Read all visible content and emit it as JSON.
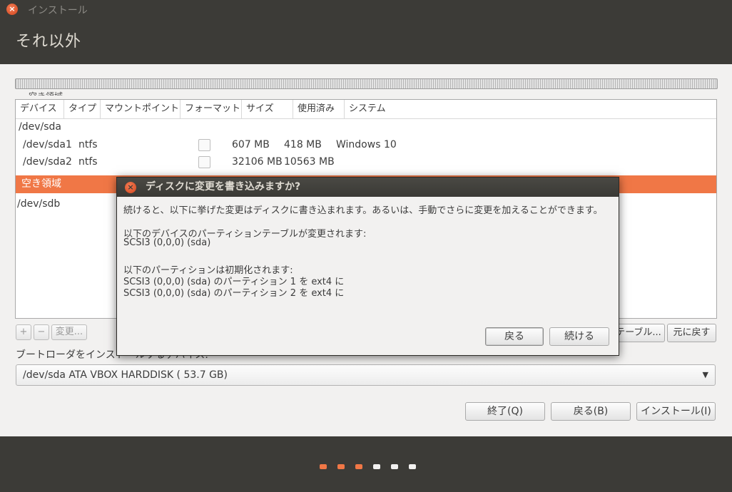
{
  "window": {
    "title": "インストール",
    "close_icon": "close-icon"
  },
  "page_title": "それ以外",
  "partition_legend_partial": "空き領域",
  "table": {
    "headers": [
      "デバイス",
      "タイプ",
      "マウントポイント",
      "フォーマット",
      "サイズ",
      "使用済み",
      "システム"
    ],
    "rows": [
      {
        "device": "/dev/sda",
        "type": "",
        "mount": "",
        "size": "",
        "used": "",
        "system": "",
        "selected": false
      },
      {
        "device": "/dev/sda1",
        "type": "ntfs",
        "mount": "",
        "size": "607 MB",
        "used": "418 MB",
        "system": "Windows 10",
        "selected": false
      },
      {
        "device": "/dev/sda2",
        "type": "ntfs",
        "mount": "",
        "size": "32106 MB",
        "used": "10563 MB",
        "system": "",
        "selected": false
      },
      {
        "device": "空き領域",
        "type": "",
        "mount": "",
        "size": "",
        "used": "",
        "system": "",
        "selected": true
      },
      {
        "device": "/dev/sdb",
        "type": "",
        "mount": "",
        "size": "",
        "used": "",
        "system": "",
        "selected": false
      }
    ]
  },
  "toolbar": {
    "add": "+",
    "remove": "−",
    "change": "変更...",
    "new_table": "テーブル...",
    "revert": "元に戻す"
  },
  "bootloader": {
    "label": "ブートローダをインストールするデバイス:",
    "selected": "/dev/sda   ATA VBOX HARDDISK ( 53.7 GB)"
  },
  "buttons": {
    "quit": "終了(Q)",
    "back": "戻る(B)",
    "install": "インストール(I)"
  },
  "dialog": {
    "title": "ディスクに変更を書き込みますか?",
    "intro": "続けると、以下に挙げた変更はディスクに書き込まれます。あるいは、手動でさらに変更を加えることができます。",
    "table_heading": "以下のデバイスのパーティションテーブルが変更されます:",
    "table_device": " SCSI3 (0,0,0) (sda)",
    "format_heading": "以下のパーティションは初期化されます:",
    "format_lines": [
      " SCSI3 (0,0,0) (sda) のパーティション 1 を ext4 に",
      " SCSI3 (0,0,0) (sda) のパーティション 2 を ext4 に"
    ],
    "back_button": "戻る",
    "continue_button": "続ける"
  },
  "progress": {
    "total_steps": 6,
    "completed_steps": 3,
    "active_color": "#f07746",
    "inactive_color": "#f2f1f0"
  }
}
